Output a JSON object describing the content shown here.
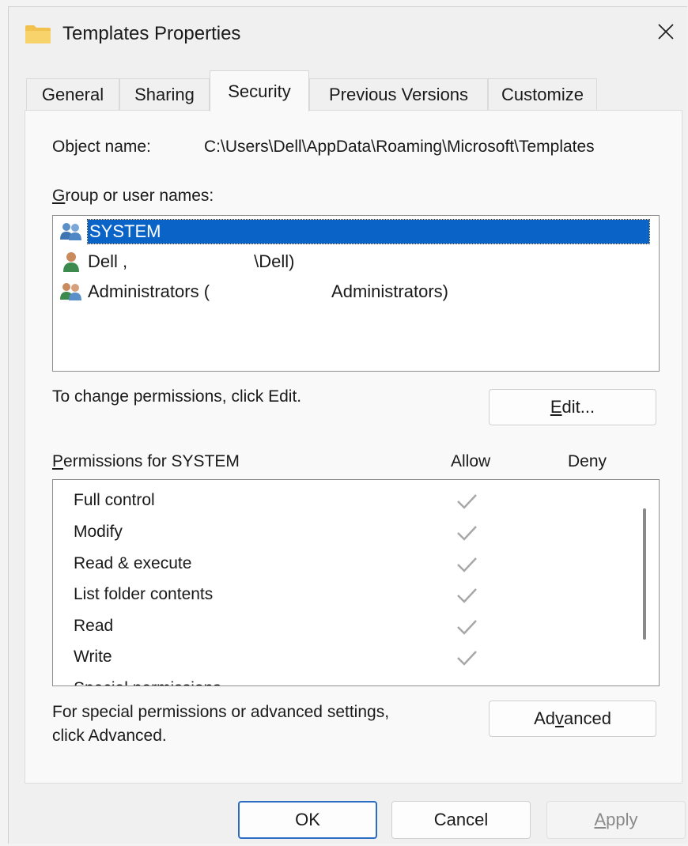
{
  "window": {
    "title": "Templates Properties",
    "folder_icon": "folder-icon",
    "close_icon": "close-icon"
  },
  "tabs": [
    {
      "label": "General"
    },
    {
      "label": "Sharing"
    },
    {
      "label": "Security",
      "active": true
    },
    {
      "label": "Previous Versions"
    },
    {
      "label": "Customize"
    }
  ],
  "security": {
    "object_name_label": "Object name:",
    "object_name_value": "C:\\Users\\Dell\\AppData\\Roaming\\Microsoft\\Templates",
    "group_label_pre": "G",
    "group_label_rest": "roup or user names:",
    "users": [
      {
        "name": "SYSTEM",
        "icon": "users-group-icon",
        "selected": true
      },
      {
        "name_a": "Dell ,",
        "name_b": "\\Dell)",
        "icon": "user-icon"
      },
      {
        "name_a": "Administrators (",
        "name_b": "Administrators)",
        "icon": "users-group-icon"
      }
    ],
    "change_text": "To change permissions, click Edit.",
    "edit_label_u": "E",
    "edit_label_rest": "dit...",
    "permissions_label_u": "P",
    "permissions_label_rest": "ermissions for SYSTEM",
    "allow_label": "Allow",
    "deny_label": "Deny",
    "permissions": [
      {
        "name": "Full control",
        "allow": true
      },
      {
        "name": "Modify",
        "allow": true
      },
      {
        "name": "Read & execute",
        "allow": true
      },
      {
        "name": "List folder contents",
        "allow": true
      },
      {
        "name": "Read",
        "allow": true
      },
      {
        "name": "Write",
        "allow": true
      },
      {
        "name": "Special permissions",
        "allow": false
      }
    ],
    "advanced_text_1": "For special permissions or advanced settings,",
    "advanced_text_2": "click Advanced.",
    "advanced_label_pre": "Ad",
    "advanced_label_u": "v",
    "advanced_label_rest": "anced"
  },
  "footer": {
    "ok_label": "OK",
    "cancel_label": "Cancel",
    "apply_label_u": "A",
    "apply_label_rest": "pply"
  },
  "colors": {
    "selection": "#0a64c8",
    "ok_border": "#2b6cc4",
    "disabled_text": "#8a8a8a"
  }
}
